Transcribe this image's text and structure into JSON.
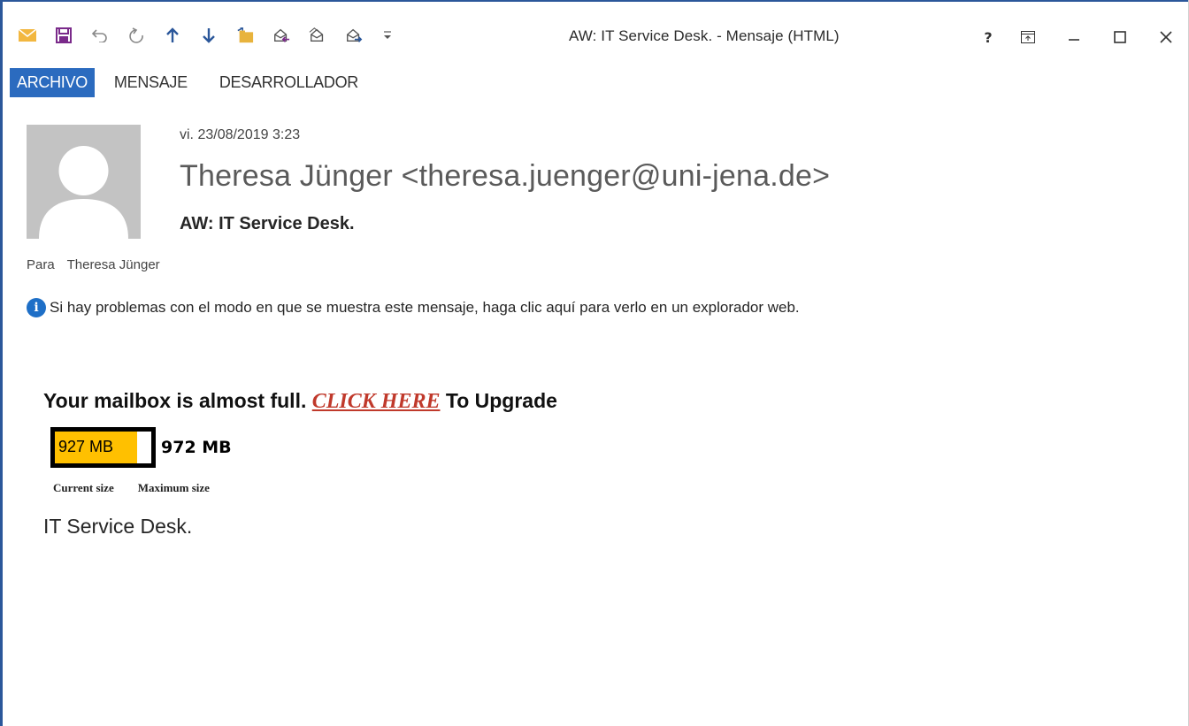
{
  "window": {
    "title": "AW: IT Service Desk. - Mensaje (HTML)",
    "controls": {
      "help": "?",
      "ribbon_display": "▣",
      "minimize": "–",
      "maximize": "☐",
      "close": "✕"
    }
  },
  "quick_access_toolbar": [
    {
      "name": "mail-icon",
      "color": "#f2b740"
    },
    {
      "name": "save-icon",
      "color": "#7a2a8a"
    },
    {
      "name": "undo-icon",
      "color": "#888888"
    },
    {
      "name": "redo-icon",
      "color": "#888888"
    },
    {
      "name": "previous-item-icon",
      "color": "#2b579a"
    },
    {
      "name": "next-item-icon",
      "color": "#2b579a"
    },
    {
      "name": "move-to-folder-icon",
      "color": "#e8b33c"
    },
    {
      "name": "reply-icon",
      "color": "#555555"
    },
    {
      "name": "reply-all-icon",
      "color": "#555555"
    },
    {
      "name": "forward-icon",
      "color": "#555555"
    },
    {
      "name": "customize-qat-icon",
      "color": "#555555"
    }
  ],
  "ribbon": {
    "tabs": [
      {
        "label": "ARCHIVO",
        "active": true
      },
      {
        "label": "MENSAJE",
        "active": false
      },
      {
        "label": "DESARROLLADOR",
        "active": false
      }
    ],
    "active_color": "#2b6bbf"
  },
  "message": {
    "date": "vi. 23/08/2019 3:23",
    "sender": "Theresa Jünger <theresa.juenger@uni-jena.de>",
    "subject": "AW: IT Service Desk.",
    "to_label": "Para",
    "to_value": "Theresa Jünger",
    "info_text": "Si hay problemas con el modo en que se muestra este mensaje, haga clic aquí para verlo en un explorador web."
  },
  "body": {
    "headline_before": "Your mailbox is almost full. ",
    "headline_link": "CLICK HERE",
    "headline_after": " To Upgrade",
    "current_size": "927 MB",
    "maximum_size": "972 MB",
    "fill_fraction": 0.85,
    "fill_color": "#ffc000",
    "current_size_label": "Current size",
    "maximum_size_label": "Maximum size",
    "signature": "IT Service Desk."
  }
}
